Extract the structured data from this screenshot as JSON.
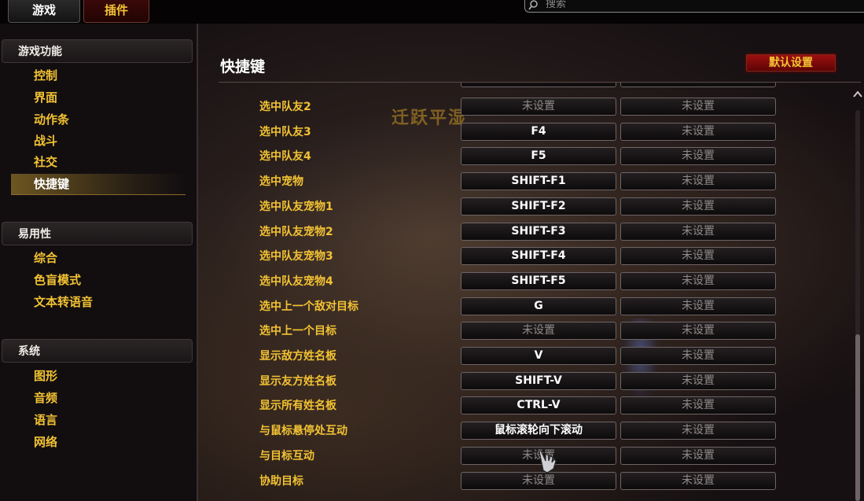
{
  "tabs": {
    "game": "游戏",
    "plugin": "插件"
  },
  "search": {
    "placeholder": "搜索"
  },
  "sidebar": {
    "sections": [
      {
        "title": "游戏功能",
        "items": [
          "控制",
          "界面",
          "动作条",
          "战斗",
          "社交",
          "快捷键"
        ]
      },
      {
        "title": "易用性",
        "items": [
          "综合",
          "色盲模式",
          "文本转语音"
        ]
      },
      {
        "title": "系统",
        "items": [
          "图形",
          "音频",
          "语言",
          "网络"
        ]
      }
    ],
    "active_item": "快捷键"
  },
  "main": {
    "title": "快捷键",
    "default_button": "默认设置",
    "watermark": "迁跃平湿"
  },
  "keybinds": [
    {
      "action": "选中队友2",
      "key1": "未设置",
      "key2": "未设置"
    },
    {
      "action": "选中队友3",
      "key1": "F4",
      "key2": "未设置"
    },
    {
      "action": "选中队友4",
      "key1": "F5",
      "key2": "未设置"
    },
    {
      "action": "选中宠物",
      "key1": "SHIFT-F1",
      "key2": "未设置"
    },
    {
      "action": "选中队友宠物1",
      "key1": "SHIFT-F2",
      "key2": "未设置"
    },
    {
      "action": "选中队友宠物2",
      "key1": "SHIFT-F3",
      "key2": "未设置"
    },
    {
      "action": "选中队友宠物3",
      "key1": "SHIFT-F4",
      "key2": "未设置"
    },
    {
      "action": "选中队友宠物4",
      "key1": "SHIFT-F5",
      "key2": "未设置"
    },
    {
      "action": "选中上一个敌对目标",
      "key1": "G",
      "key2": "未设置"
    },
    {
      "action": "选中上一个目标",
      "key1": "未设置",
      "key2": "未设置"
    },
    {
      "action": "显示敌方姓名板",
      "key1": "V",
      "key2": "未设置"
    },
    {
      "action": "显示友方姓名板",
      "key1": "SHIFT-V",
      "key2": "未设置"
    },
    {
      "action": "显示所有姓名板",
      "key1": "CTRL-V",
      "key2": "未设置"
    },
    {
      "action": "与鼠标悬停处互动",
      "key1": "鼠标滚轮向下滚动",
      "key2": "未设置"
    },
    {
      "action": "与目标互动",
      "key1": "未设置",
      "key2": "未设置"
    },
    {
      "action": "协助目标",
      "key1": "未设置",
      "key2": "未设置"
    }
  ],
  "unset_label": "未设置",
  "colors": {
    "accent_gold": "#f2c233",
    "button_red": "#a01010",
    "unset_text": "#8f8a88"
  }
}
